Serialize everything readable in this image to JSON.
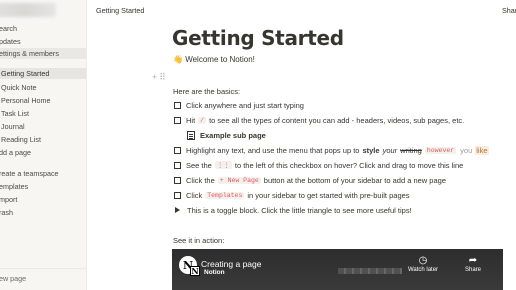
{
  "sidebar": {
    "items": [
      {
        "label": "earch"
      },
      {
        "label": "pdates"
      },
      {
        "label": "ettings & members"
      },
      {
        "label": "Getting Started"
      },
      {
        "label": "Quick Note"
      },
      {
        "label": "Personal Home"
      },
      {
        "label": "Task List"
      },
      {
        "label": "Journal"
      },
      {
        "label": "Reading List"
      },
      {
        "label": "dd a page"
      },
      {
        "label": "reate a teamspace"
      },
      {
        "label": "emplates"
      },
      {
        "label": "mport"
      },
      {
        "label": "rash"
      }
    ],
    "new_page": "ew page"
  },
  "topbar": {
    "title": "Getting Started",
    "share": "Shar"
  },
  "page": {
    "title": "Getting Started",
    "welcome_emoji": "👋",
    "welcome": "Welcome to Notion!",
    "basics": "Here are the basics:",
    "todo1": "Click anywhere and just start typing",
    "todo2_a": "Hit",
    "todo2_code": "/",
    "todo2_b": "to see all the types of content you can add - headers, videos, sub pages, etc.",
    "subpage": "Example sub page",
    "todo3_a": "Highlight any text, and use the menu that pops up to",
    "todo3_style": "style",
    "todo3_your": "your",
    "todo3_writing": "writing",
    "todo3_code": "however",
    "todo3_you": "you",
    "todo3_like": "like",
    "todo4_a": "See the",
    "todo4_code": "⋮⋮",
    "todo4_b": "to the left of this checkbox on hover? Click and drag to move this line",
    "todo5_a": "Click the",
    "todo5_code": "+ New Page",
    "todo5_b": "button at the bottom of your sidebar to add a new page",
    "todo6_a": "Click",
    "todo6_code": "Templates",
    "todo6_b": "in your sidebar to get started with pre-built pages",
    "toggle": "This is a toggle block. Click the little triangle to see more useful tips!",
    "see_in_action": "See it in action:"
  },
  "video": {
    "title": "Creating a page",
    "brand": "Notion",
    "logo_letter": "N",
    "watch_later": "Watch later",
    "share": "Share"
  },
  "icons": {
    "handle": "drag-handle-icon",
    "plus": "plus-icon"
  }
}
